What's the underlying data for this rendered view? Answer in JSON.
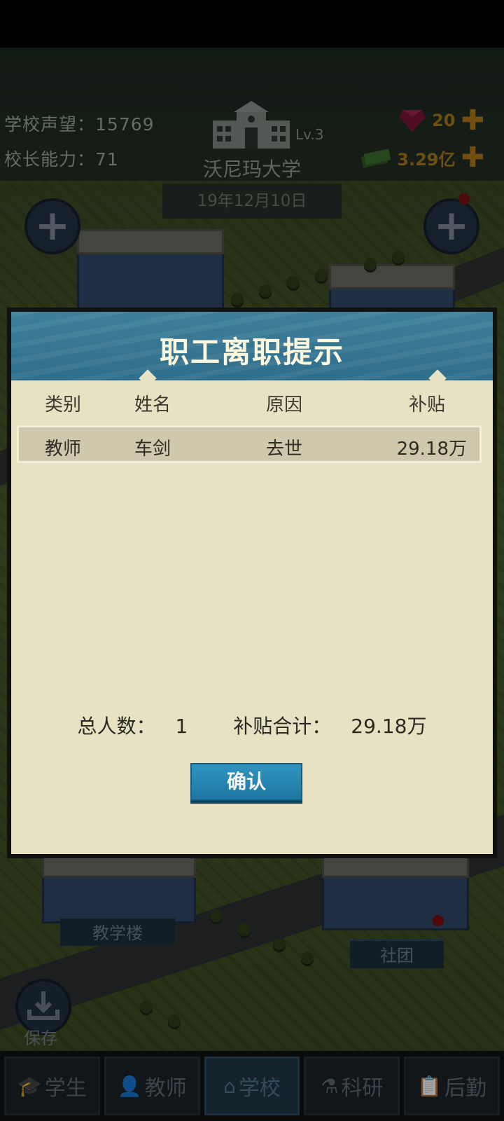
{
  "hud": {
    "reputation_label": "学校声望：",
    "reputation_value": "15769",
    "ability_label": "校长能力：",
    "ability_value": "71",
    "school_name": "沃尼玛大学",
    "school_level": "Lv.3",
    "date": "19年12月10日",
    "gems": "20",
    "cash": "3.29亿"
  },
  "map_labels": {
    "teaching_building": "教学楼",
    "club": "社团",
    "save": "保存"
  },
  "modal": {
    "title": "职工离职提示",
    "columns": [
      "类别",
      "姓名",
      "原因",
      "补贴"
    ],
    "rows": [
      {
        "category": "教师",
        "name": "车剑",
        "reason": "去世",
        "subsidy": "29.18万"
      }
    ],
    "total_count_label": "总人数：",
    "total_count_value": "1",
    "total_subsidy_label": "补贴合计：",
    "total_subsidy_value": "29.18万",
    "confirm_label": "确认"
  },
  "nav": {
    "tabs": [
      {
        "label": "学生",
        "icon": "student-icon"
      },
      {
        "label": "教师",
        "icon": "teacher-icon"
      },
      {
        "label": "学校",
        "icon": "school-icon",
        "active": true
      },
      {
        "label": "科研",
        "icon": "flask-icon"
      },
      {
        "label": "后勤",
        "icon": "clipboard-icon"
      }
    ]
  },
  "colors": {
    "modal_header": "#3e7f9a",
    "modal_body": "#e6e2c3",
    "confirm_button": "#2f94c0",
    "currency_gold": "#a77a1c"
  }
}
